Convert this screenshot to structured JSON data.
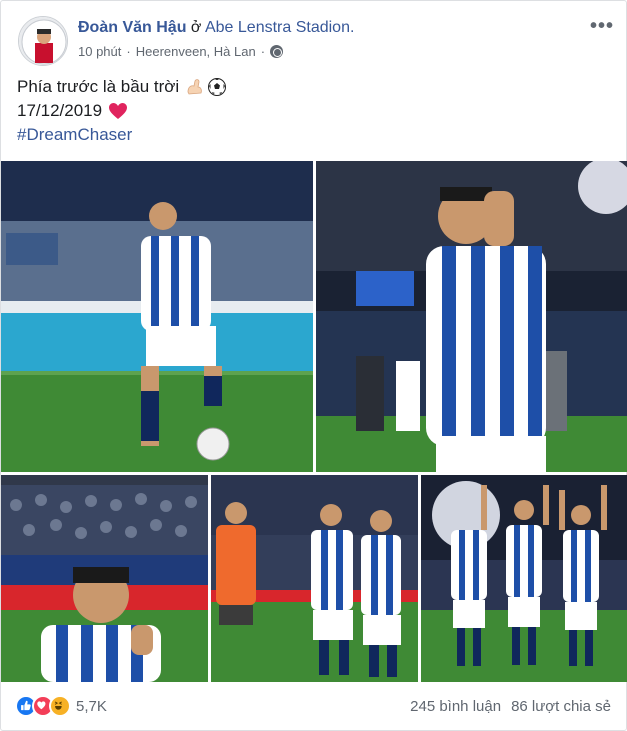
{
  "post": {
    "author": "Đoàn Văn Hậu",
    "location_prefix": "ở",
    "location": "Abe Lenstra Stadion.",
    "time": "10 phút",
    "dot": "·",
    "place": "Heerenveen, Hà Lan",
    "dot2": "·",
    "privacy_icon": "globe-icon",
    "more_label": "•••",
    "text_line1": "Phía trước là bầu trời",
    "text_line1_emojis": [
      "flexed-bicep-icon",
      "soccer-ball-icon"
    ],
    "date": "17/12/2019",
    "date_emoji": "heart-icon",
    "hashtag": "#DreamChaser"
  },
  "photos": [
    {
      "name": "photo-player-dribbling"
    },
    {
      "name": "photo-player-clapping"
    },
    {
      "name": "photo-selfie-fans"
    },
    {
      "name": "photo-team-holding-hands"
    },
    {
      "name": "photo-team-celebrating"
    }
  ],
  "footer": {
    "reactions": [
      "like-icon",
      "love-icon",
      "haha-icon"
    ],
    "reaction_count": "5,7K",
    "comments": "245 bình luận",
    "shares": "86 lượt chia sẻ"
  },
  "colors": {
    "link": "#385898",
    "meta": "#606770",
    "jersey_blue": "#1e4fa8",
    "pitch": "#3f8a35"
  }
}
